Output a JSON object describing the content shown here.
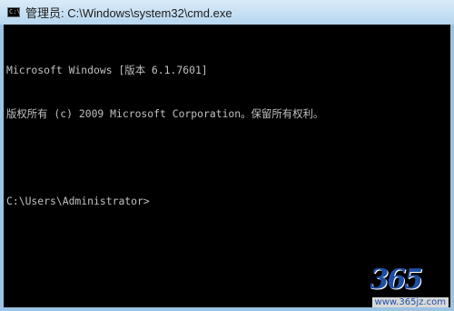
{
  "window": {
    "title": "管理员: C:\\Windows\\system32\\cmd.exe",
    "icon": "cmd-icon"
  },
  "console": {
    "lines": [
      "Microsoft Windows [版本 6.1.7601]",
      "版权所有 (c) 2009 Microsoft Corporation。保留所有权利。",
      "",
      "C:\\Users\\Administrator>"
    ]
  },
  "watermark": {
    "logo_digits": "365",
    "url": "www.365jz.com"
  },
  "colors": {
    "console_bg": "#000000",
    "console_text": "#c0c0c0",
    "titlebar": "#c4def3"
  }
}
